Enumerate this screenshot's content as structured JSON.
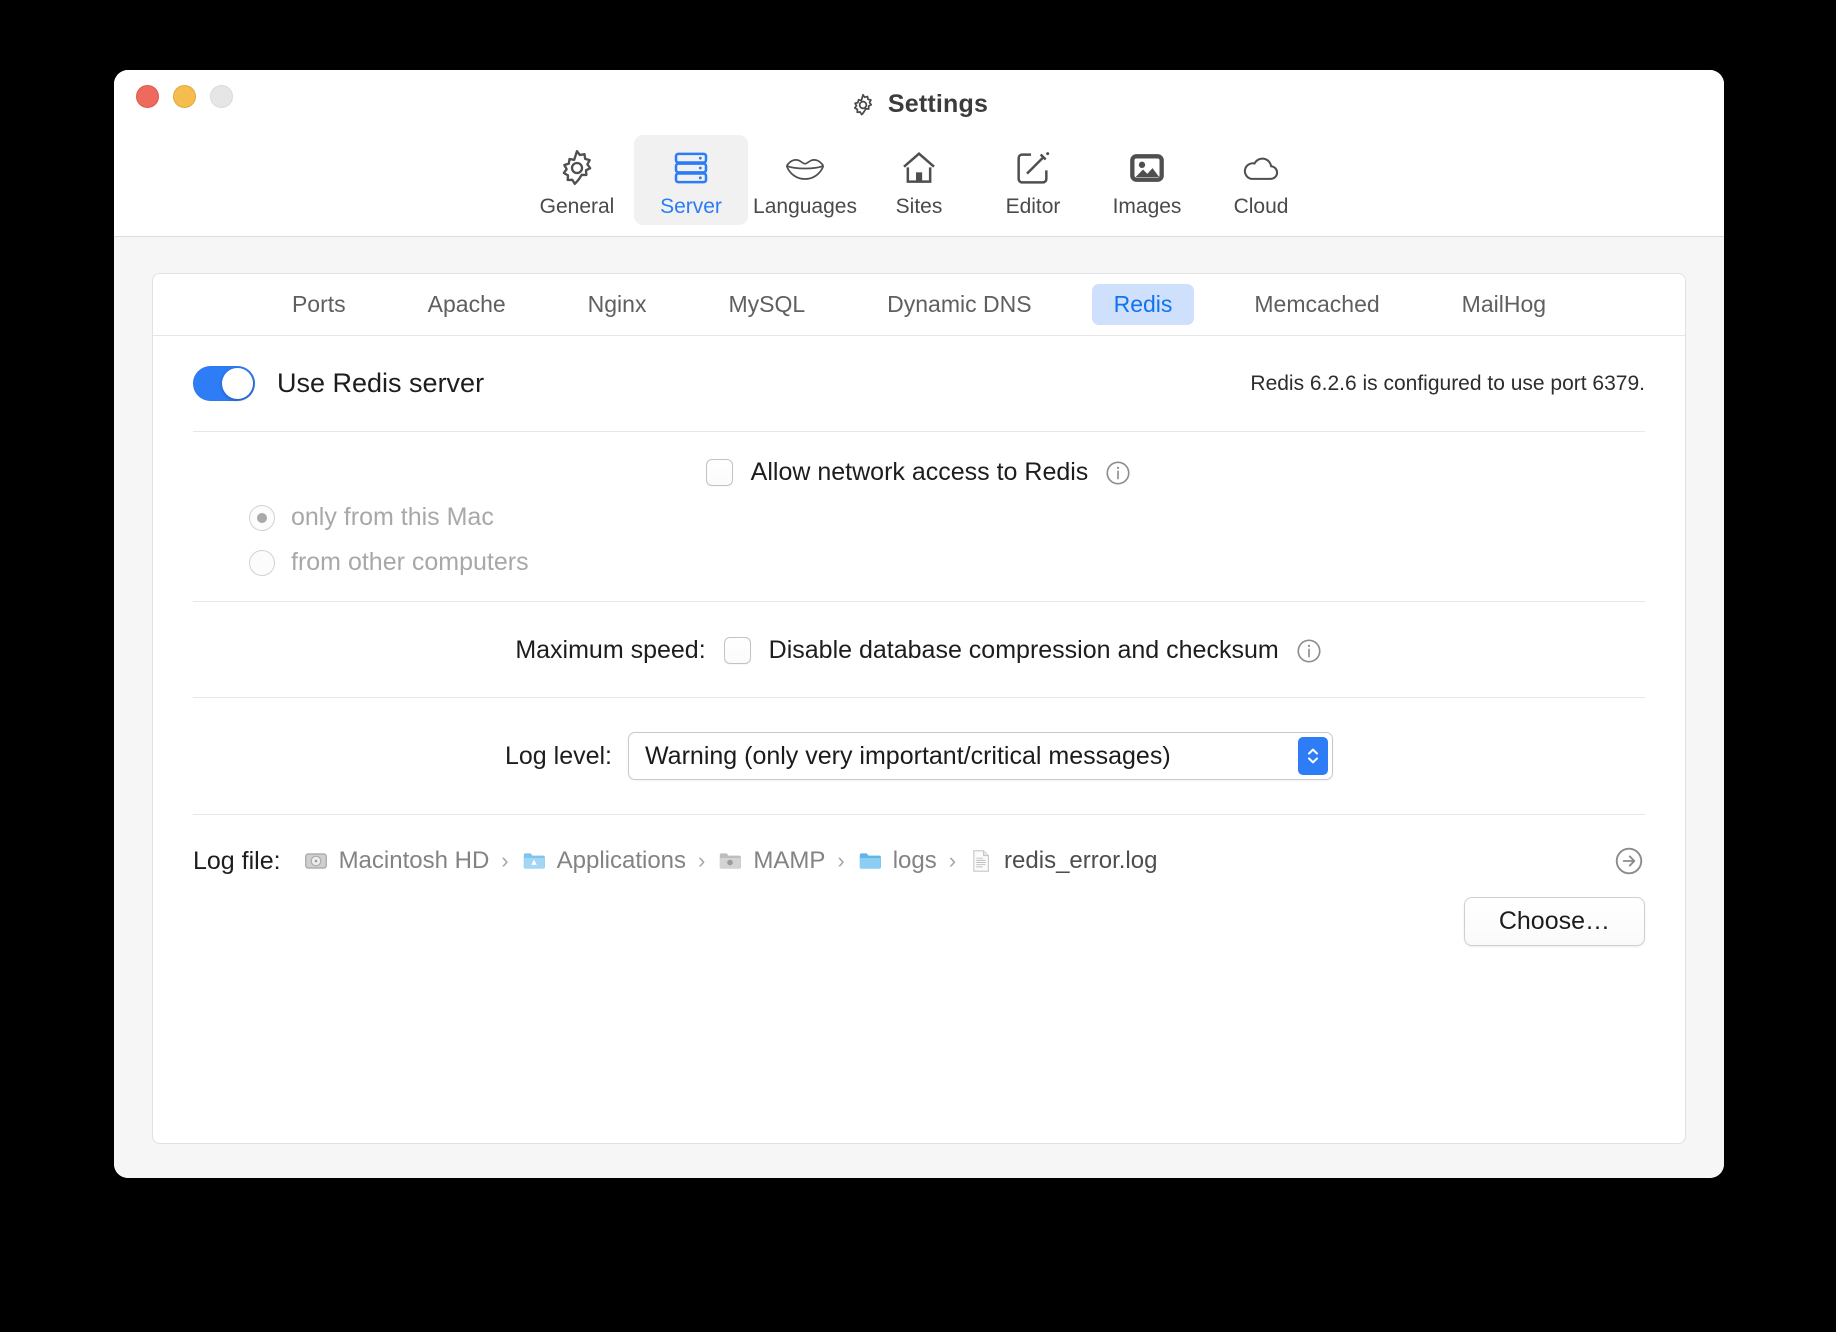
{
  "window": {
    "title": "Settings",
    "title_icon": "gear-icon",
    "traffic_lights": [
      "close",
      "minimize",
      "zoom"
    ]
  },
  "toolbar": {
    "items": [
      {
        "label": "General",
        "icon": "gear-icon",
        "active": false
      },
      {
        "label": "Server",
        "icon": "server-icon",
        "active": true
      },
      {
        "label": "Languages",
        "icon": "lips-icon",
        "active": false
      },
      {
        "label": "Sites",
        "icon": "house-icon",
        "active": false
      },
      {
        "label": "Editor",
        "icon": "pencil-square-icon",
        "active": false
      },
      {
        "label": "Images",
        "icon": "photo-icon",
        "active": false
      },
      {
        "label": "Cloud",
        "icon": "cloud-icon",
        "active": false
      }
    ]
  },
  "subtabs": {
    "items": [
      {
        "label": "Ports",
        "active": false
      },
      {
        "label": "Apache",
        "active": false
      },
      {
        "label": "Nginx",
        "active": false
      },
      {
        "label": "MySQL",
        "active": false
      },
      {
        "label": "Dynamic DNS",
        "active": false
      },
      {
        "label": "Redis",
        "active": true
      },
      {
        "label": "Memcached",
        "active": false
      },
      {
        "label": "MailHog",
        "active": false
      }
    ],
    "active_color": "#1273ef",
    "active_bg": "#cfe0fd"
  },
  "redis": {
    "use_server_label": "Use Redis server",
    "use_server_on": true,
    "status_text": "Redis 6.2.6 is configured to use port 6379.",
    "network": {
      "checkbox_label": "Allow network access to Redis",
      "checked": false,
      "info_icon": "info-circle-icon",
      "radios": [
        {
          "label": "only from this Mac",
          "selected": true,
          "disabled": true
        },
        {
          "label": "from other computers",
          "selected": false,
          "disabled": true
        }
      ]
    },
    "max_speed": {
      "label": "Maximum speed:",
      "checkbox_label": "Disable database compression and checksum",
      "checked": false,
      "info_icon": "info-circle-icon"
    },
    "log_level": {
      "label": "Log level:",
      "value": "Warning (only very important/critical messages)"
    },
    "log_file": {
      "label": "Log file:",
      "crumbs": [
        {
          "text": "Macintosh HD",
          "icon": "hard-disk-icon"
        },
        {
          "text": "Applications",
          "icon": "applications-folder-icon"
        },
        {
          "text": "MAMP",
          "icon": "mamp-folder-icon"
        },
        {
          "text": "logs",
          "icon": "folder-icon"
        },
        {
          "text": "redis_error.log",
          "icon": "document-icon"
        }
      ],
      "separator": "›",
      "reveal_icon": "arrow-right-circle-icon",
      "choose_label": "Choose…"
    }
  },
  "colors": {
    "accent_blue": "#2e7cf6",
    "tab_active_bg": "#cfe0fd",
    "window_bg": "#f6f6f6"
  }
}
